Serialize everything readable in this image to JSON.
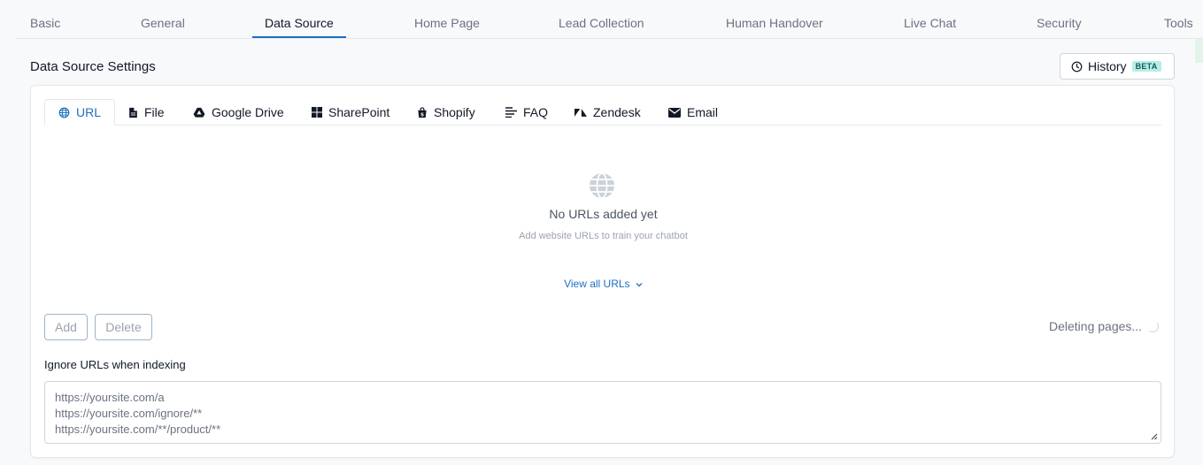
{
  "nav": {
    "tabs": [
      "Basic",
      "General",
      "Data Source",
      "Home Page",
      "Lead Collection",
      "Human Handover",
      "Live Chat",
      "Security",
      "Tools"
    ],
    "active_tab": "Data Source"
  },
  "settings": {
    "title": "Data Source Settings",
    "history_label": "History",
    "history_badge": "BETA"
  },
  "source_tabs": [
    {
      "label": "URL",
      "icon": "globe-icon",
      "active": true
    },
    {
      "label": "File",
      "icon": "file-icon"
    },
    {
      "label": "Google Drive",
      "icon": "google-drive-icon"
    },
    {
      "label": "SharePoint",
      "icon": "sharepoint-icon"
    },
    {
      "label": "Shopify",
      "icon": "shopify-icon"
    },
    {
      "label": "FAQ",
      "icon": "faq-icon"
    },
    {
      "label": "Zendesk",
      "icon": "zendesk-icon"
    },
    {
      "label": "Email",
      "icon": "envelope-icon"
    }
  ],
  "empty_state": {
    "icon": "globe-icon",
    "title": "No URLs added yet",
    "subtitle": "Add website URLs to train your chatbot"
  },
  "view_all_label": "View all URLs",
  "actions": {
    "add_label": "Add",
    "delete_label": "Delete",
    "status_text": "Deleting pages..."
  },
  "ignore": {
    "label": "Ignore URLs when indexing",
    "lines": [
      "https://yoursite.com/a",
      "https://yoursite.com/ignore/**",
      "https://yoursite.com/**/product/**"
    ]
  },
  "colors": {
    "accent": "#1e6fbf",
    "badge_bg": "#b8ece8",
    "muted_text": "#6b7280"
  }
}
